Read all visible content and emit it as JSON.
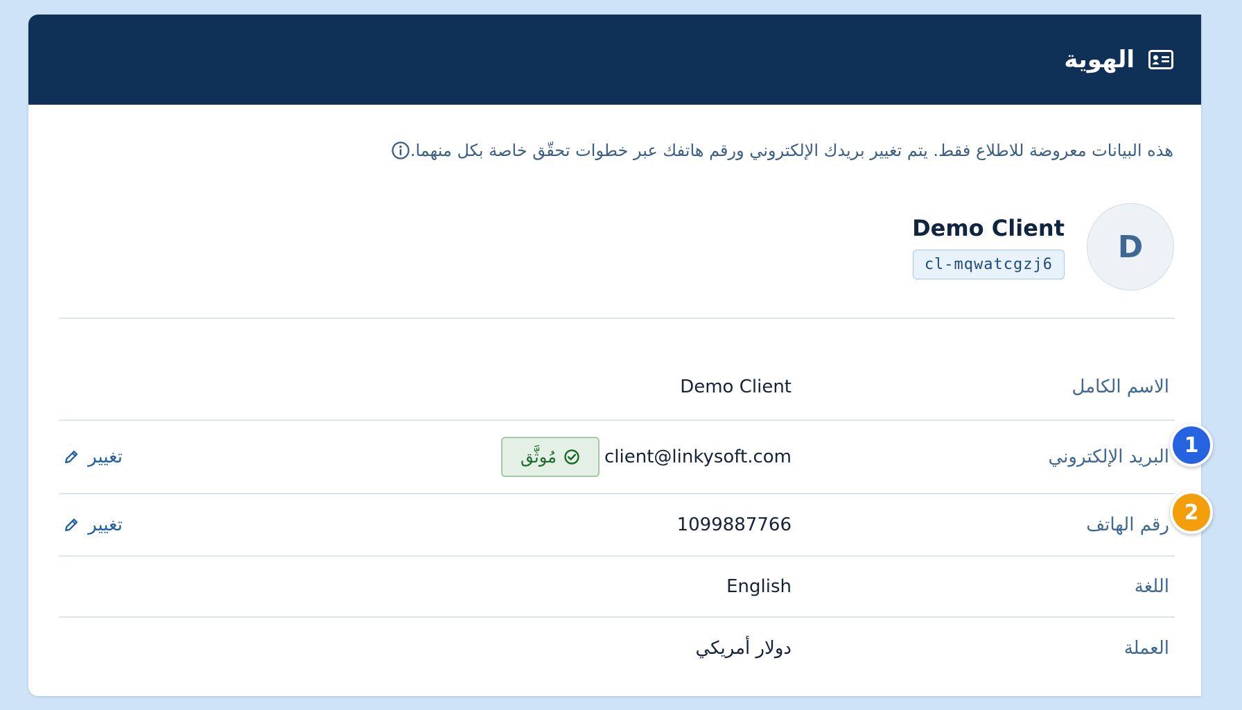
{
  "header": {
    "title": "الهوية",
    "icon": "id-card-icon"
  },
  "notice": {
    "icon": "info-icon",
    "text": "هذه البيانات معروضة للاطلاع فقط. يتم تغيير بريدك الإلكتروني ورقم هاتفك عبر خطوات تحقّق خاصة بكل منهما."
  },
  "profile": {
    "avatar_letter": "D",
    "name": "Demo Client",
    "client_id": "cl-mqwatcgzj6"
  },
  "fields": {
    "full_name": {
      "label": "الاسم الكامل",
      "value": "Demo Client"
    },
    "email": {
      "label": "البريد الإلكتروني",
      "value": "client@linkysoft.com",
      "verified_label": "مُوثَّق",
      "change_label": "تغيير"
    },
    "phone": {
      "label": "رقم الهاتف",
      "value": "1099887766",
      "change_label": "تغيير"
    },
    "language": {
      "label": "اللغة",
      "value": "English"
    },
    "currency": {
      "label": "العملة",
      "value": "دولار أمريكي"
    }
  },
  "markers": {
    "one": {
      "number": "1",
      "color": "#2563e0"
    },
    "two": {
      "number": "2",
      "color": "#f59e0b"
    }
  },
  "colors": {
    "header_bg": "#0f3158",
    "page_bg": "#cfe3f7",
    "label": "#3e6791",
    "link": "#1f5fa4",
    "verified": "#1a6a2a"
  }
}
